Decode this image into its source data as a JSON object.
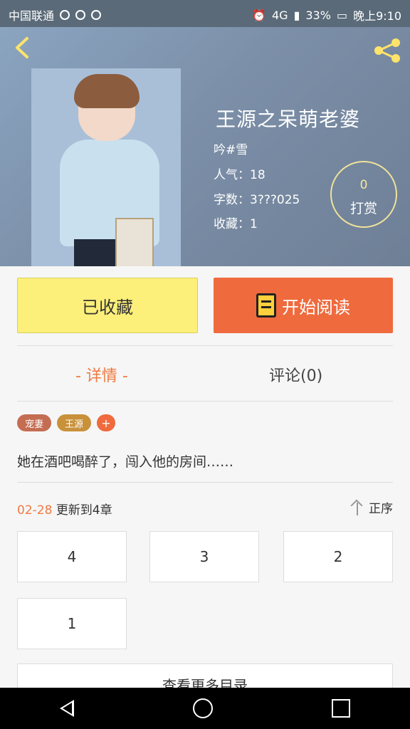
{
  "status_bar": {
    "carrier": "中国联通",
    "network": "4G",
    "battery": "33%",
    "time": "晚上9:10"
  },
  "book": {
    "title": "王源之呆萌老婆",
    "author": "吟#雪",
    "popularity": "人气：18",
    "word_count": "字数：3???025",
    "favorites": "收藏：1"
  },
  "reward": {
    "count": "0",
    "label": "打赏"
  },
  "actions": {
    "favorited_label": "已收藏",
    "read_label": "开始阅读"
  },
  "tabs": {
    "detail": "- 详情 -",
    "comments": "评论(0)"
  },
  "tags": [
    "宠妻",
    "王源",
    "+"
  ],
  "summary": "她在酒吧喝醉了，闯入他的房间……",
  "update": {
    "date": "02-28",
    "text": "更新到4章",
    "order_label": "正序"
  },
  "chapters": [
    "4",
    "3",
    "2",
    "1"
  ],
  "more_button": "查看更多目录",
  "colors": {
    "accent": "#ef6a3d",
    "favorite_bg": "#fdf07a",
    "tag_1": "#c46d53",
    "tag_2": "#c8913a"
  }
}
